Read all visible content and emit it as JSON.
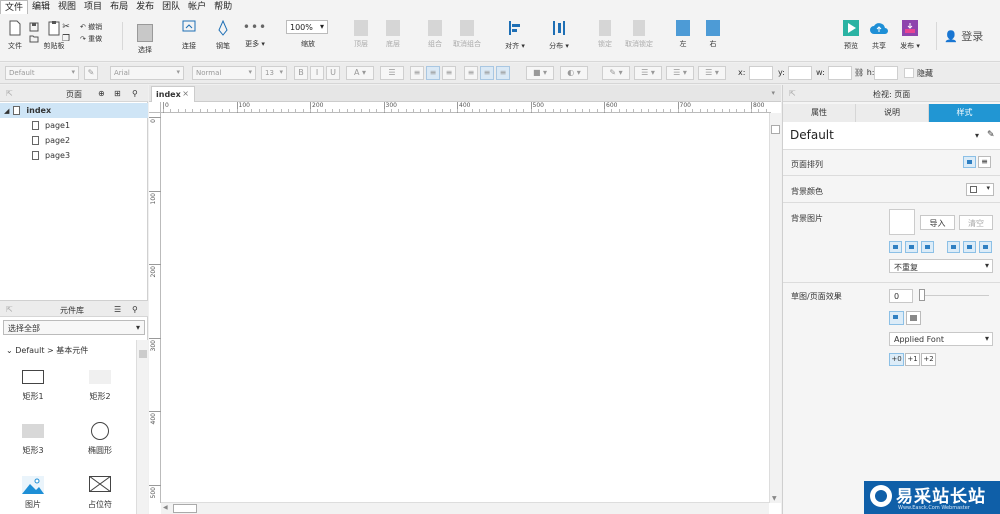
{
  "menu": [
    "文件",
    "编辑",
    "视图",
    "项目",
    "布局",
    "发布",
    "团队",
    "帐户",
    "帮助"
  ],
  "toolbar": {
    "file": "文件",
    "clipboard": "剪贴板",
    "cut": "剪切",
    "copy": "复制",
    "undo": "撤销",
    "redo": "重做",
    "select": "选择",
    "connect": "连接",
    "pen": "钢笔",
    "more": "更多 ▾",
    "zoom_value": "100%",
    "zoom": "缩放",
    "top": "顶层",
    "bottom": "底层",
    "group": "组合",
    "ungroup": "取消组合",
    "align": "对齐 ▾",
    "distribute": "分布 ▾",
    "lock": "锁定",
    "unlock": "取消锁定",
    "left": "左",
    "right": "右",
    "preview": "预览",
    "share": "共享",
    "publish": "发布 ▾",
    "login": "登录"
  },
  "format": {
    "style": "Default",
    "font": "Arial",
    "weight": "Normal",
    "size": "13",
    "x_label": "x:",
    "y_label": "y:",
    "w_label": "w:",
    "h_label": "h:",
    "hidden": "隐藏"
  },
  "pages_panel": {
    "title": "页面",
    "items": [
      "index",
      "page1",
      "page2",
      "page3"
    ]
  },
  "widgets_panel": {
    "title": "元件库",
    "select_all": "选择全部",
    "group": "Default > 基本元件",
    "items": [
      "矩形1",
      "矩形2",
      "矩形3",
      "椭圆形",
      "图片",
      "占位符"
    ]
  },
  "canvas": {
    "tab": "index",
    "ruler_h": [
      "0",
      "100",
      "200",
      "300",
      "400",
      "500",
      "600",
      "700",
      "800"
    ],
    "ruler_v": [
      "0",
      "100",
      "200",
      "300",
      "400",
      "500"
    ]
  },
  "inspector": {
    "title": "检视: 页面",
    "tabs": [
      "属性",
      "说明",
      "样式"
    ],
    "style_name": "Default",
    "page_align": "页面排列",
    "bg_color": "背景颜色",
    "bg_image": "背景图片",
    "import": "导入",
    "clear": "清空",
    "repeat": "不重复",
    "sketch": "草图/页面效果",
    "sketch_value": "0",
    "font": "Applied Font",
    "font_adj": [
      "+0",
      "+1",
      "+2"
    ]
  },
  "watermark": {
    "title": "易采站长站",
    "sub": "Www.Easck.Com Webmaster"
  }
}
